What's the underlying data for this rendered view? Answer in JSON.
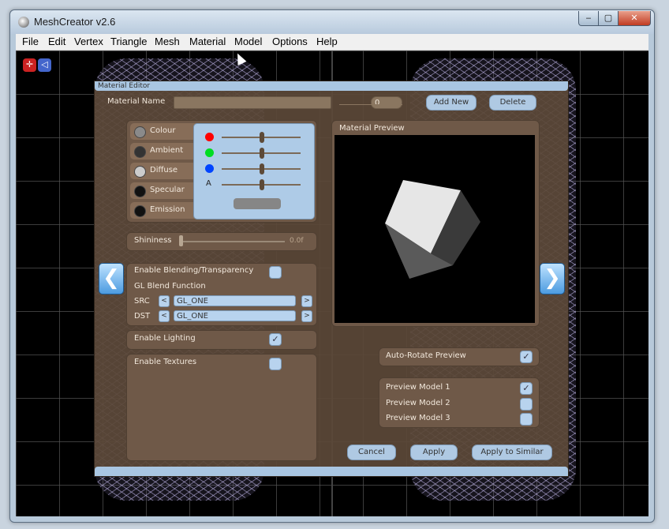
{
  "window": {
    "title": "MeshCreator v2.6",
    "minimize": "‒",
    "maximize": "▢",
    "close": "✕"
  },
  "menu": [
    "File",
    "Edit",
    "Vertex",
    "Triangle",
    "Mesh",
    "Material",
    "Model",
    "Options",
    "Help"
  ],
  "editor": {
    "title": "Material Editor",
    "material_name_label": "Material Name",
    "material_name_value": "",
    "material_index": "0",
    "add_new": "Add New",
    "delete": "Delete",
    "color_rows": [
      {
        "label": "Colour",
        "swatch": "#8a8a8a"
      },
      {
        "label": "Ambient",
        "swatch": "#333333"
      },
      {
        "label": "Diffuse",
        "swatch": "#cccccc"
      },
      {
        "label": "Specular",
        "swatch": "#111111"
      },
      {
        "label": "Emission",
        "swatch": "#111111"
      }
    ],
    "channel_alpha_label": "A",
    "shininess_label": "Shininess",
    "shininess_value": "0.0f",
    "blending_label": "Enable Blending/Transparency",
    "blend_function_label": "GL Blend Function",
    "src_label": "SRC",
    "src_value": "GL_ONE",
    "dst_label": "DST",
    "dst_value": "GL_ONE",
    "lighting_label": "Enable Lighting",
    "textures_label": "Enable Textures",
    "preview_label": "Material Preview",
    "auto_rotate_label": "Auto-Rotate Preview",
    "preview_models": [
      "Preview Model 1",
      "Preview Model 2",
      "Preview Model 3"
    ],
    "cancel": "Cancel",
    "apply": "Apply",
    "apply_similar": "Apply to Similar",
    "check_mark": "✓",
    "left_small": "<",
    "right_small": ">",
    "nav_left": "❮",
    "nav_right": "❯"
  },
  "colors": {
    "red": "#ff0000",
    "green": "#00dd22",
    "blue": "#0044ff",
    "accent": "#a9c6e2",
    "panel_brown": "#5b4838"
  }
}
